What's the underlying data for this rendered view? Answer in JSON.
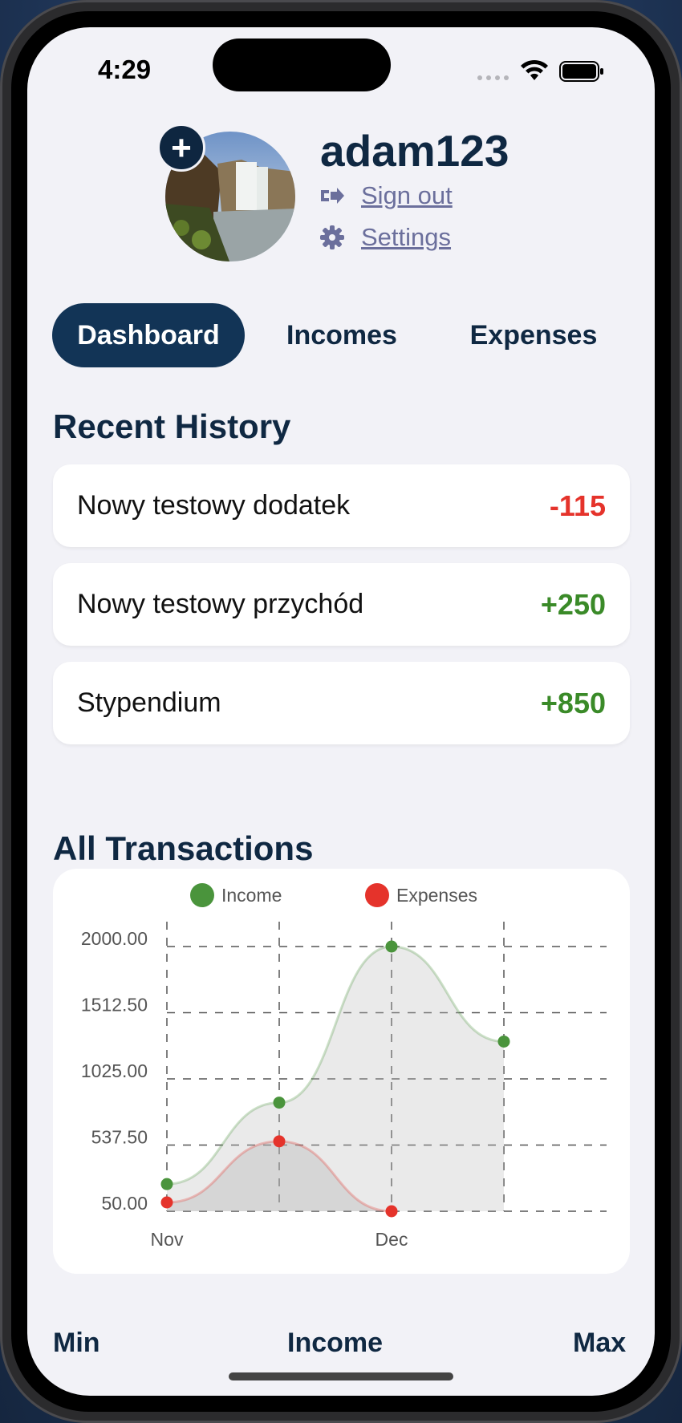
{
  "status": {
    "time": "4:29"
  },
  "profile": {
    "username": "adam123",
    "sign_out": "Sign out",
    "settings": "Settings",
    "add_symbol": "+"
  },
  "tabs": [
    {
      "label": "Dashboard",
      "active": true
    },
    {
      "label": "Incomes",
      "active": false
    },
    {
      "label": "Expenses",
      "active": false
    }
  ],
  "recent": {
    "title": "Recent History",
    "items": [
      {
        "name": "Nowy testowy dodatek",
        "amount": "-115",
        "type": "expense"
      },
      {
        "name": "Nowy testowy przychód",
        "amount": "+250",
        "type": "income"
      },
      {
        "name": "Stypendium",
        "amount": "+850",
        "type": "income"
      }
    ]
  },
  "all_transactions": {
    "title": "All Transactions"
  },
  "chart_data": {
    "type": "line",
    "x_tick_labels": [
      "Nov",
      "Dec"
    ],
    "ytick_labels": [
      "2000.00",
      "1512.50",
      "1025.00",
      "537.50",
      "50.00"
    ],
    "ylim": [
      50,
      2000
    ],
    "grid": true,
    "legend_position": "top",
    "series": [
      {
        "name": "Income",
        "color": "#4a943c",
        "values": [
          250,
          850,
          2000,
          1300
        ]
      },
      {
        "name": "Expenses",
        "color": "#e5332b",
        "values": [
          115,
          565,
          50
        ]
      }
    ]
  },
  "bottom_stats": {
    "min": "Min",
    "income": "Income",
    "max": "Max"
  },
  "colors": {
    "primary": "#123456",
    "positive": "#3a8a28",
    "negative": "#e5332b",
    "background": "#f2f2f7"
  }
}
